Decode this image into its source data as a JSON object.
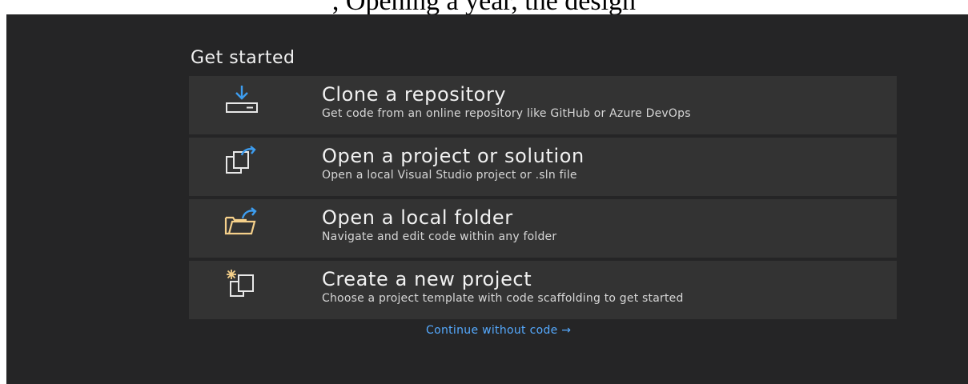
{
  "caption": {
    "text": ", Opening a year, the design"
  },
  "start_window": {
    "heading": "Get started",
    "options": [
      {
        "title": "Clone a repository",
        "description": "Get code from an online repository like GitHub or Azure DevOps",
        "icon": "clone-download-icon"
      },
      {
        "title": "Open a project or solution",
        "description": "Open a local Visual Studio project or .sln file",
        "icon": "open-project-icon"
      },
      {
        "title": "Open a local folder",
        "description": "Navigate and edit code within any folder",
        "icon": "open-folder-icon"
      },
      {
        "title": "Create a new project",
        "description": "Choose a project template with code scaffolding to get started",
        "icon": "new-project-icon"
      }
    ],
    "continue_link": "Continue without code →"
  },
  "colors": {
    "background": "#252526",
    "card": "#333333",
    "text": "#f1f1f1",
    "link": "#55aaff",
    "icon_accent": "#3d9df0",
    "folder": "#f5d08a"
  }
}
